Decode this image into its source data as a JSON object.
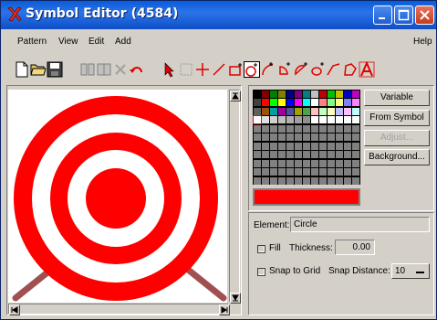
{
  "window": {
    "title": "Symbol Editor (4584)"
  },
  "menu": {
    "pattern": "Pattern",
    "view": "View",
    "edit": "Edit",
    "add": "Add",
    "help": "Help"
  },
  "palette_colors": [
    [
      "#000000",
      "#800000",
      "#008000",
      "#808000",
      "#000080",
      "#800080",
      "#008080",
      "#c0c0c0",
      "#c00000",
      "#00c000",
      "#c0c000",
      "#0000c0",
      "#c000c0"
    ],
    [
      "#404040",
      "#ff0000",
      "#00ff00",
      "#ffff00",
      "#0000ff",
      "#ff00ff",
      "#00ffff",
      "#ffffff",
      "#ff8080",
      "#80ff80",
      "#ffff80",
      "#8080ff",
      "#ff80ff"
    ],
    [
      "#606060",
      "#a05000",
      "#00a0a0",
      "#a000a0",
      "#5050a0",
      "#a0a000",
      "#50a050",
      "#ffc0c0",
      "#c0ffc0",
      "#ffffc0",
      "#c0c0ff",
      "#ffc0ff",
      "#c0ffff"
    ],
    [
      "#ffffff",
      "#e0e0e0",
      "#d0d0d0",
      "#c0c0c0",
      "#b0b0b0",
      "#a0a0a0",
      "#909090",
      "#ffffff",
      "#ffffff",
      "#ffffff",
      "#ffffff",
      "#ffffff",
      "#ffffff"
    ]
  ],
  "selected_color": "#ff0000",
  "buttons": {
    "variable": "Variable",
    "from_symbol": "From Symbol",
    "adjust": "Adjust...",
    "background": "Background..."
  },
  "properties": {
    "element_label": "Element:",
    "element_value": "Circle",
    "fill_label": "Fill",
    "thickness_label": "Thickness:",
    "thickness_value": "0.00",
    "snap_label": "Snap to Grid",
    "snap_distance_label": "Snap Distance:",
    "snap_distance_value": "10"
  },
  "canvas": {
    "target_colors": [
      "#ff0000",
      "#ffffff"
    ],
    "stand_color": "#a05050"
  }
}
